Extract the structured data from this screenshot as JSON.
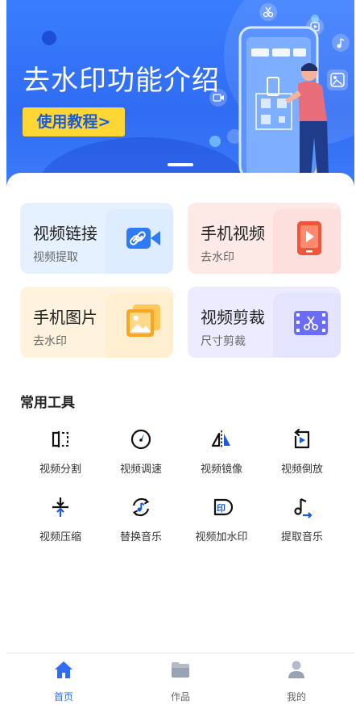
{
  "banner": {
    "title": "去水印功能介绍",
    "button_label": "使用教程>"
  },
  "cards": [
    {
      "title": "视频链接",
      "subtitle": "视频提取",
      "bg": "#e6f1ff",
      "icon": "link-icon",
      "accent": "#2f7bf5"
    },
    {
      "title": "手机视频",
      "subtitle": "去水印",
      "bg": "#fde9e6",
      "icon": "play-phone-icon",
      "accent": "#f0563a"
    },
    {
      "title": "手机图片",
      "subtitle": "去水印",
      "bg": "#fff3de",
      "icon": "image-icon",
      "accent": "#f5a623"
    },
    {
      "title": "视频剪裁",
      "subtitle": "尺寸剪裁",
      "bg": "#ecebff",
      "icon": "scissors-film-icon",
      "accent": "#6b6cf5"
    }
  ],
  "tools": {
    "title": "常用工具",
    "items": [
      {
        "label": "视频分割",
        "icon": "split-icon"
      },
      {
        "label": "视频调速",
        "icon": "speed-dial-icon"
      },
      {
        "label": "视频镜像",
        "icon": "mirror-icon"
      },
      {
        "label": "视频倒放",
        "icon": "rewind-play-icon"
      },
      {
        "label": "视频压缩",
        "icon": "compress-icon"
      },
      {
        "label": "替换音乐",
        "icon": "replace-music-icon"
      },
      {
        "label": "视频加水印",
        "icon": "add-watermark-icon"
      },
      {
        "label": "提取音乐",
        "icon": "extract-music-icon"
      }
    ]
  },
  "nav": {
    "items": [
      {
        "label": "首页",
        "icon": "home-icon",
        "active": true
      },
      {
        "label": "作品",
        "icon": "folder-icon",
        "active": false
      },
      {
        "label": "我的",
        "icon": "user-icon",
        "active": false
      }
    ],
    "active_color": "#2f6cf2",
    "inactive_color": "#666666"
  }
}
